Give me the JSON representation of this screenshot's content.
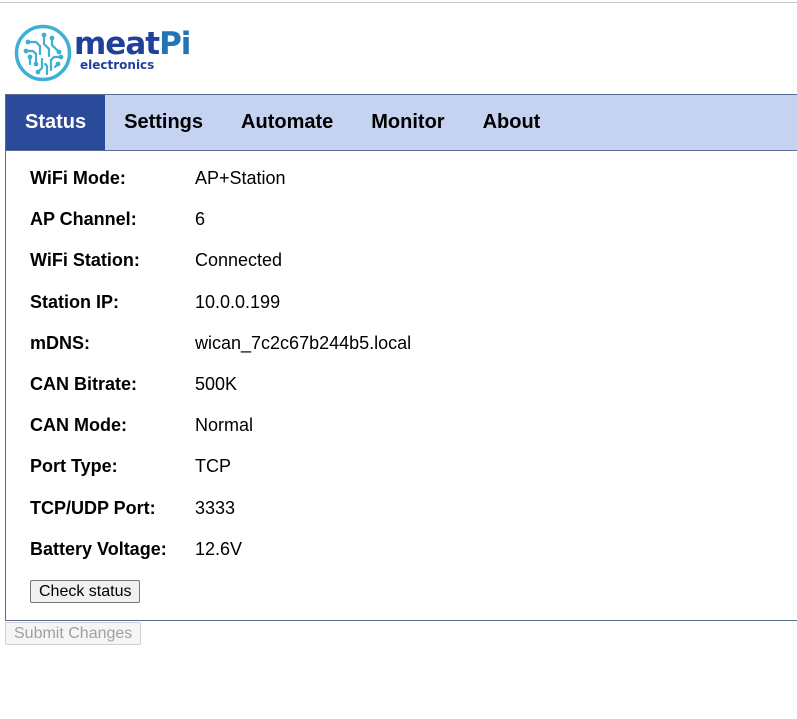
{
  "brand": {
    "name_part1": "meat",
    "name_part2": "Pi",
    "subtitle": "electronics",
    "primary_color": "#21409a",
    "accent_color": "#1f75b8",
    "logo_ring_color": "#3fb0d4"
  },
  "tabs": [
    {
      "label": "Status",
      "active": true
    },
    {
      "label": "Settings",
      "active": false
    },
    {
      "label": "Automate",
      "active": false
    },
    {
      "label": "Monitor",
      "active": false
    },
    {
      "label": "About",
      "active": false
    }
  ],
  "status": [
    {
      "label": "WiFi Mode:",
      "value": "AP+Station"
    },
    {
      "label": "AP Channel:",
      "value": "6"
    },
    {
      "label": "WiFi Station:",
      "value": "Connected"
    },
    {
      "label": "Station IP:",
      "value": "10.0.0.199"
    },
    {
      "label": "mDNS:",
      "value": "wican_7c2c67b244b5.local"
    },
    {
      "label": "CAN Bitrate:",
      "value": "500K"
    },
    {
      "label": "CAN Mode:",
      "value": "Normal"
    },
    {
      "label": "Port Type:",
      "value": "TCP"
    },
    {
      "label": "TCP/UDP Port:",
      "value": "3333"
    },
    {
      "label": "Battery Voltage:",
      "value": "12.6V"
    }
  ],
  "buttons": {
    "check_status": "Check status",
    "submit_changes": "Submit Changes"
  },
  "theme": {
    "tab_active_bg": "#2b4a9a",
    "tab_bar_bg": "#c5d2f0"
  }
}
